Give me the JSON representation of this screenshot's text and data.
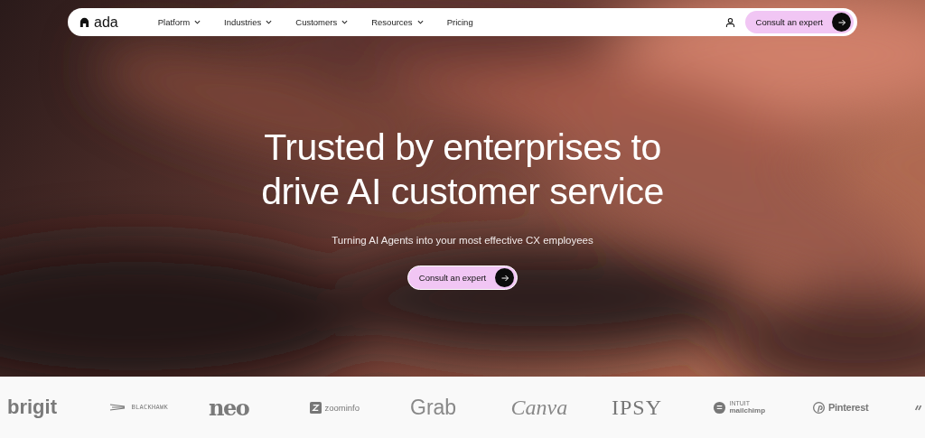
{
  "nav": {
    "brand": "ada",
    "items": [
      {
        "label": "Platform",
        "dropdown": true
      },
      {
        "label": "Industries",
        "dropdown": true
      },
      {
        "label": "Customers",
        "dropdown": true
      },
      {
        "label": "Resources",
        "dropdown": true
      },
      {
        "label": "Pricing",
        "dropdown": false
      }
    ],
    "cta": "Consult an expert"
  },
  "hero": {
    "title_lines": [
      "Trusted by enterprises to",
      "drive AI customer service"
    ],
    "subtitle": "Turning AI Agents into your most effective CX employees",
    "cta": "Consult an expert"
  },
  "logos": [
    {
      "kind": "brigit",
      "text": "brigit"
    },
    {
      "kind": "blackhawk",
      "text": "BLACKHAWK"
    },
    {
      "kind": "neo",
      "text": "neo"
    },
    {
      "kind": "zoominfo",
      "text": "zoominfo"
    },
    {
      "kind": "grab",
      "text": "Grab"
    },
    {
      "kind": "canva",
      "text": "Canva"
    },
    {
      "kind": "ipsy",
      "text": "IPSY"
    },
    {
      "kind": "mailchimp",
      "text": "INTUIT",
      "text2": "mailchimp"
    },
    {
      "kind": "pinterest",
      "text": "Pinterest"
    }
  ]
}
